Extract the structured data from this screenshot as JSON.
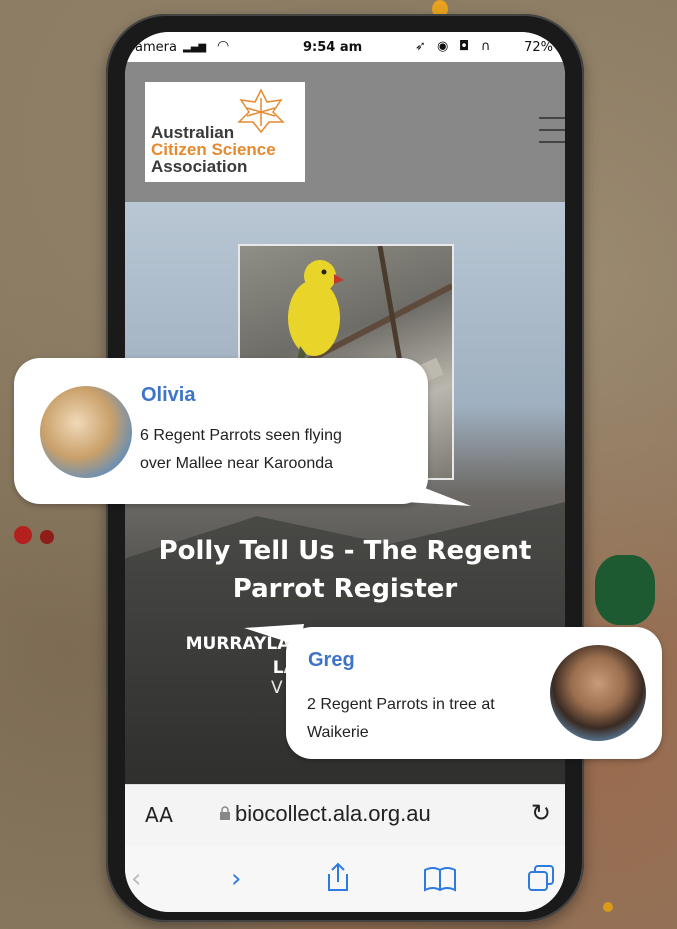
{
  "statusbar": {
    "carrier": "amera",
    "time": "9:54 am",
    "battery": "72%"
  },
  "site": {
    "logo_lines": [
      "Australian",
      "Citizen Science",
      "Association"
    ],
    "logo_colors": [
      "#3a3a3a",
      "#e58a2e",
      "#3a3a3a"
    ]
  },
  "hero": {
    "title": "Polly Tell Us - The Regent Parrot Register",
    "org_line1": "MURRAYLA",
    "org_line2": "LAN",
    "org_line3": "V"
  },
  "browser": {
    "aa_label": "AA",
    "url": "biocollect.ala.org.au",
    "icons": [
      "back-icon",
      "forward-icon",
      "share-icon",
      "bookmarks-icon",
      "tabs-icon"
    ],
    "accent": "#2d7ae0"
  },
  "messages": [
    {
      "name": "Olivia",
      "text_line1": "6 Regent Parrots seen flying",
      "text_line2": "over Mallee near Karoonda"
    },
    {
      "name": "Greg",
      "text_line1": "2 Regent Parrots in tree at",
      "text_line2": "Waikerie"
    }
  ],
  "colors": {
    "name_text": "#3e74c7",
    "parrot_yellow": "#e9d52a"
  }
}
